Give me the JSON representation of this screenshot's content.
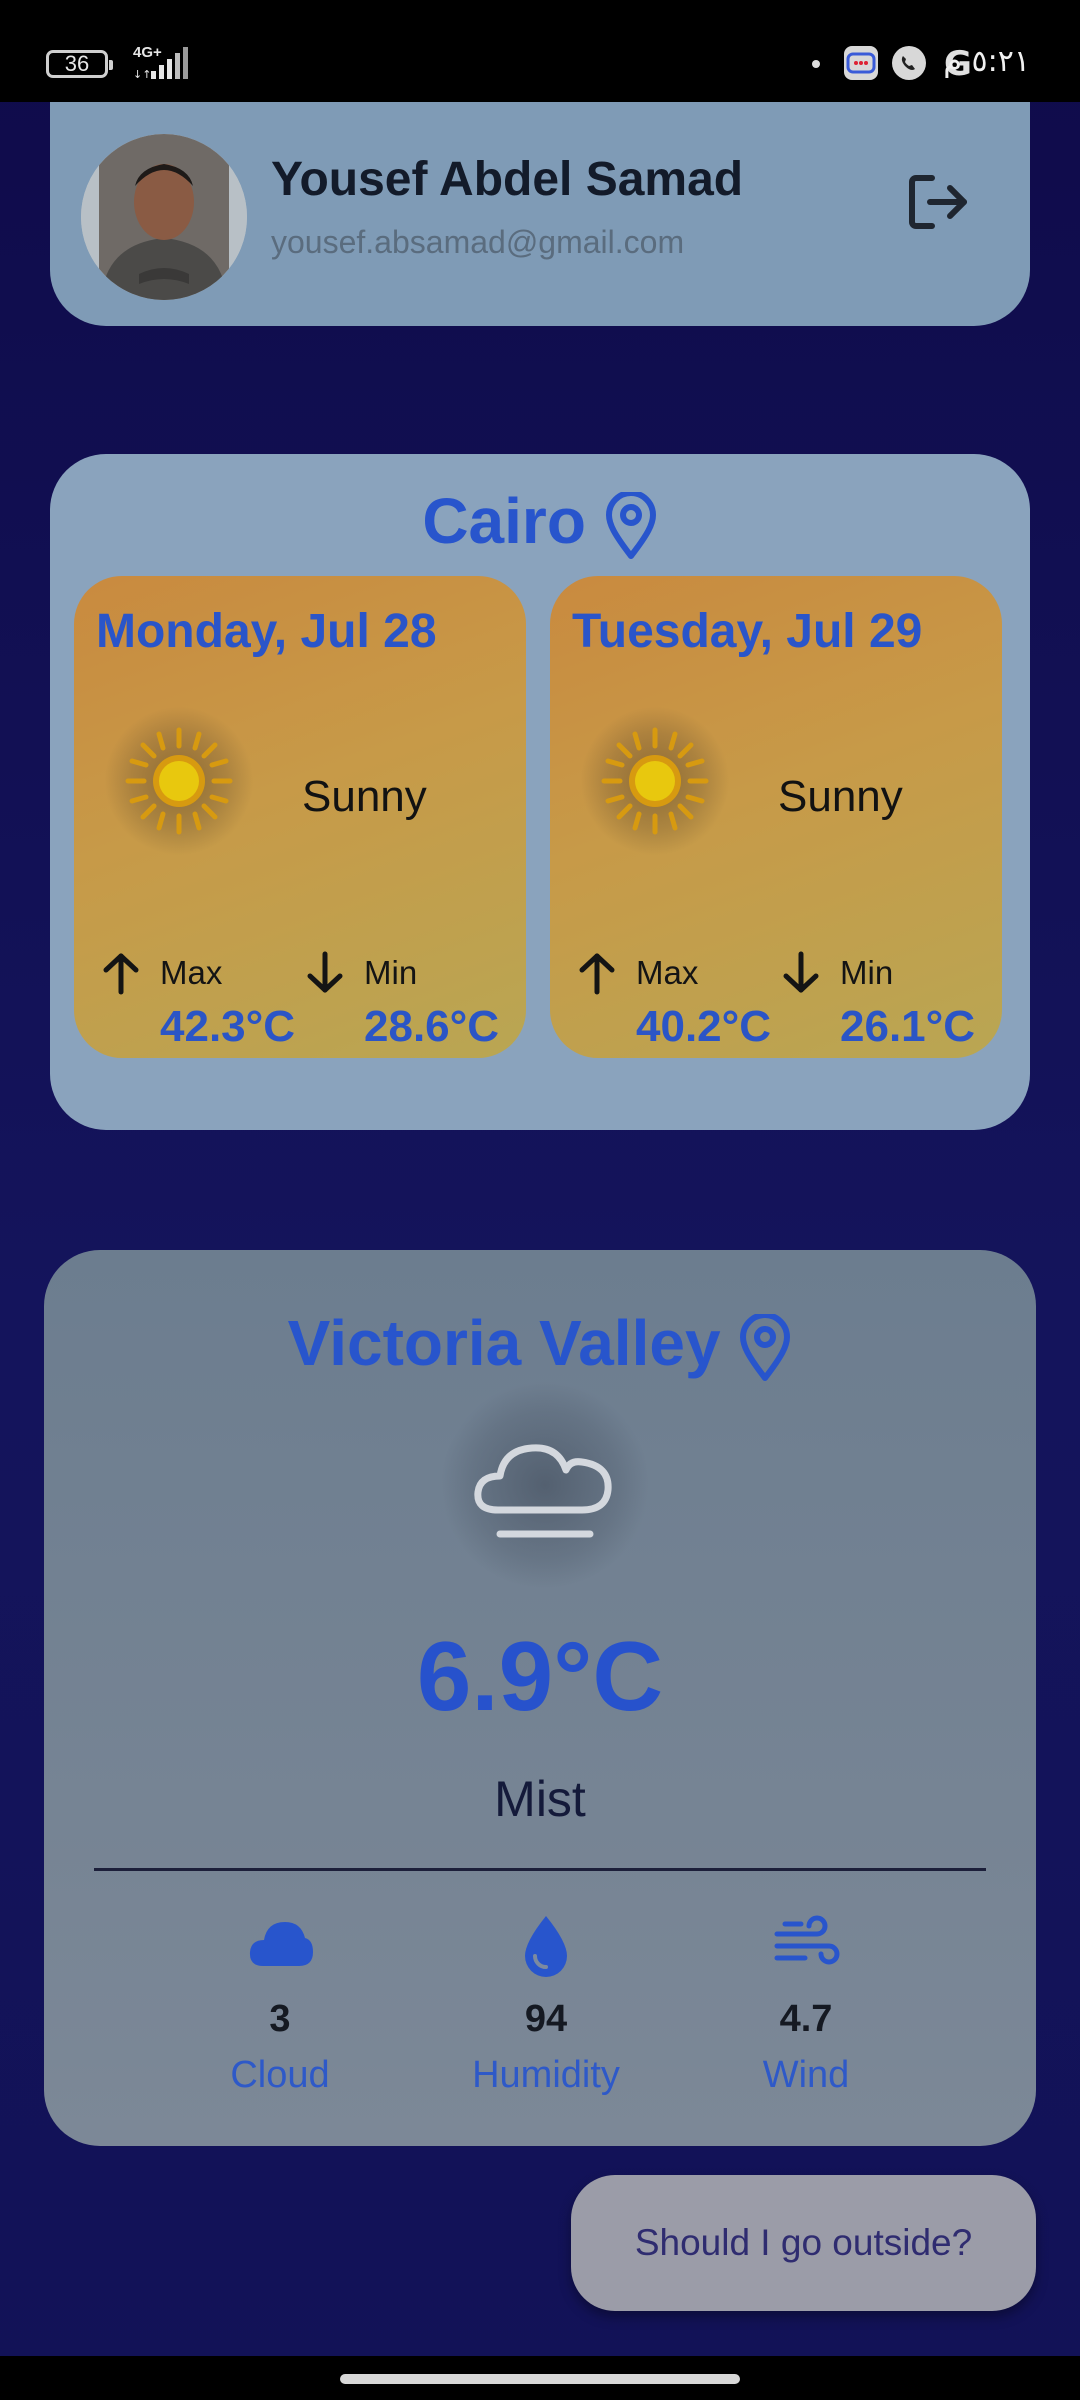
{
  "status_bar": {
    "battery": "36",
    "network": "4G+",
    "time": "٥:٢١ م"
  },
  "profile": {
    "name": "Yousef Abdel Samad",
    "email": "yousef.absamad@gmail.com"
  },
  "cairo": {
    "city": "Cairo",
    "days": [
      {
        "title": "Monday, Jul 28",
        "condition": "Sunny",
        "max_label": "Max",
        "max_value": "42.3°C",
        "min_label": "Min",
        "min_value": "28.6°C"
      },
      {
        "title": "Tuesday, Jul 29",
        "condition": "Sunny",
        "max_label": "Max",
        "max_value": "40.2°C",
        "min_label": "Min",
        "min_value": "26.1°C"
      }
    ]
  },
  "current": {
    "city": "Victoria Valley",
    "temperature": "6.9°C",
    "condition": "Mist",
    "stats": [
      {
        "icon": "cloud-icon",
        "value": "3",
        "label": "Cloud"
      },
      {
        "icon": "water-drop-icon",
        "value": "94",
        "label": "Humidity"
      },
      {
        "icon": "wind-icon",
        "value": "4.7",
        "label": "Wind"
      }
    ]
  },
  "cta": {
    "label": "Should I go outside?"
  },
  "colors": {
    "accent": "#2855cc",
    "background": "#0f0b4a",
    "sunny_card": "#c79a48"
  }
}
